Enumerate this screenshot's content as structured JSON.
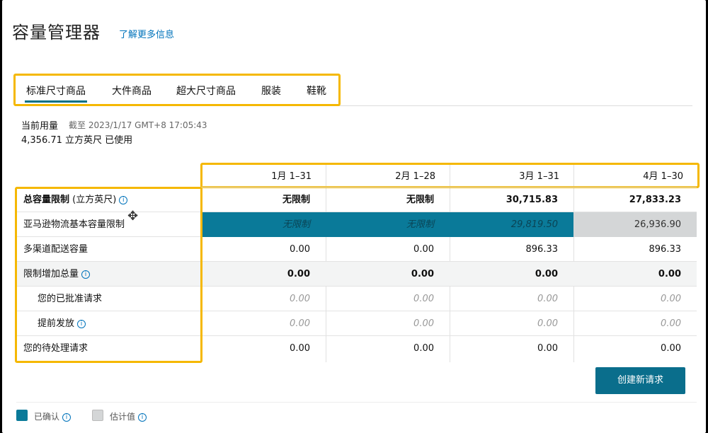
{
  "header": {
    "title": "容量管理器",
    "learn_more": "了解更多信息"
  },
  "tabs": [
    {
      "label": "标准尺寸商品",
      "active": true
    },
    {
      "label": "大件商品",
      "active": false
    },
    {
      "label": "超大尺寸商品",
      "active": false
    },
    {
      "label": "服装",
      "active": false
    },
    {
      "label": "鞋靴",
      "active": false
    }
  ],
  "usage": {
    "label": "当前用量",
    "as_of": "截至 2023/1/17 GMT+8 17:05:43",
    "value": "4,356.71 立方英尺 已使用"
  },
  "table": {
    "columns": [
      "1月 1–31",
      "2月 1–28",
      "3月 1–31",
      "4月 1–30"
    ],
    "rows": [
      {
        "label": "总容量限制",
        "label_suffix": " (立方英尺)",
        "info": true,
        "values": [
          "无限制",
          "无限制",
          "30,715.83",
          "27,833.23"
        ]
      },
      {
        "label": "亚马逊物流基本容量限制",
        "values": [
          "无限制",
          "无限制",
          "29,819.50",
          "26,936.90"
        ]
      },
      {
        "label": "多渠道配送容量",
        "values": [
          "0.00",
          "0.00",
          "896.33",
          "896.33"
        ]
      },
      {
        "label": "限制增加总量",
        "info": true,
        "values": [
          "0.00",
          "0.00",
          "0.00",
          "0.00"
        ]
      },
      {
        "label": "您的已批准请求",
        "values": [
          "0.00",
          "0.00",
          "0.00",
          "0.00"
        ]
      },
      {
        "label": "提前发放",
        "info": true,
        "values": [
          "0.00",
          "0.00",
          "0.00",
          "0.00"
        ]
      },
      {
        "label": "您的待处理请求",
        "values": [
          "0.00",
          "0.00",
          "0.00",
          "0.00"
        ]
      }
    ]
  },
  "actions": {
    "create_request": "创建新请求"
  },
  "legend": [
    {
      "label": "已确认",
      "color": "#0a7a99"
    },
    {
      "label": "估计值",
      "color": "#d4d6d7"
    }
  ],
  "colors": {
    "accent": "#0073bb",
    "highlight": "#f5b800",
    "confirmed": "#0a7a99",
    "estimated": "#d4d6d7"
  }
}
